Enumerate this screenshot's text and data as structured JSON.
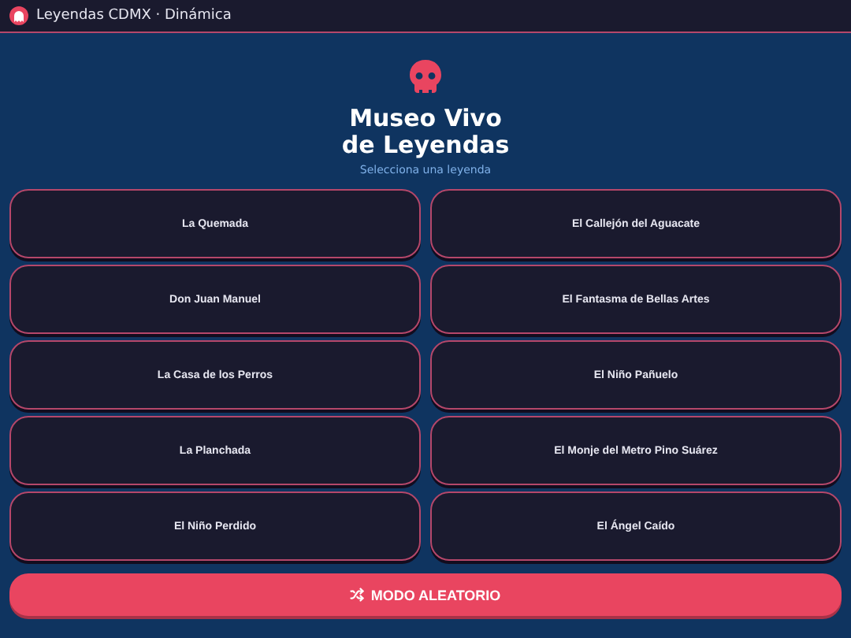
{
  "window": {
    "title": "Leyendas CDMX · Dinámica"
  },
  "header": {
    "title_lines": [
      "Museo Vivo",
      "de Leyendas"
    ],
    "subtitle": "Selecciona una leyenda"
  },
  "legends": [
    {
      "label": "La Quemada"
    },
    {
      "label": "El Callejón del Aguacate"
    },
    {
      "label": "Don Juan Manuel"
    },
    {
      "label": "El Fantasma de Bellas Artes"
    },
    {
      "label": "La Casa de los Perros"
    },
    {
      "label": "El Niño Pañuelo"
    },
    {
      "label": "La Planchada"
    },
    {
      "label": "El Monje del Metro Pino Suárez"
    },
    {
      "label": "El Niño Perdido"
    },
    {
      "label": "El Ángel Caído"
    }
  ],
  "random_button": {
    "label": "MODO ALEATORIO"
  }
}
